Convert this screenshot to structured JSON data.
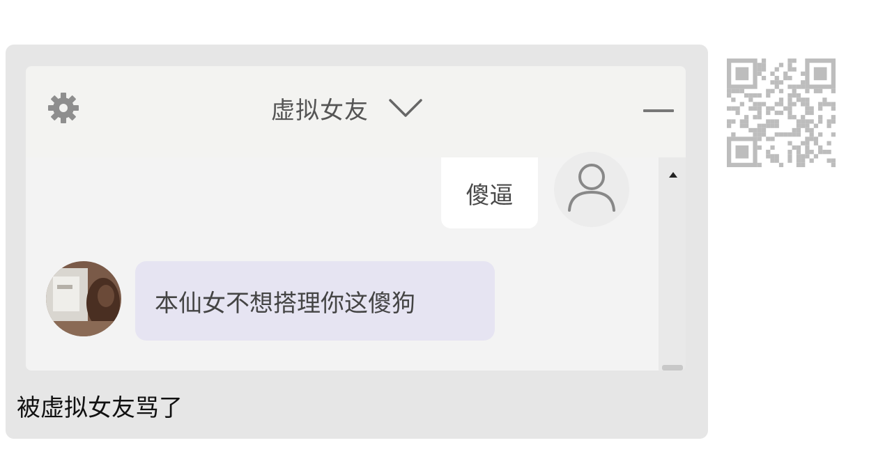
{
  "post": {
    "caption": "被虚拟女友骂了"
  },
  "chat": {
    "title": "虚拟女友",
    "icons": {
      "settings": "gear-icon",
      "title_dropdown": "chevron-down-icon",
      "minimize": "minimize-icon",
      "user_avatar": "user-silhouette-icon",
      "scroll_up": "triangle-up-icon",
      "qr": "qr-code-icon"
    },
    "messages": [
      {
        "sender": "user",
        "text": "傻逼"
      },
      {
        "sender": "bot",
        "text": "本仙女不想搭理你这傻狗"
      }
    ]
  },
  "colors": {
    "card_bg": "#e6e6e6",
    "window_bg": "#f3f3f1",
    "user_bubble": "#ffffff",
    "bot_bubble": "#e6e4f2"
  }
}
